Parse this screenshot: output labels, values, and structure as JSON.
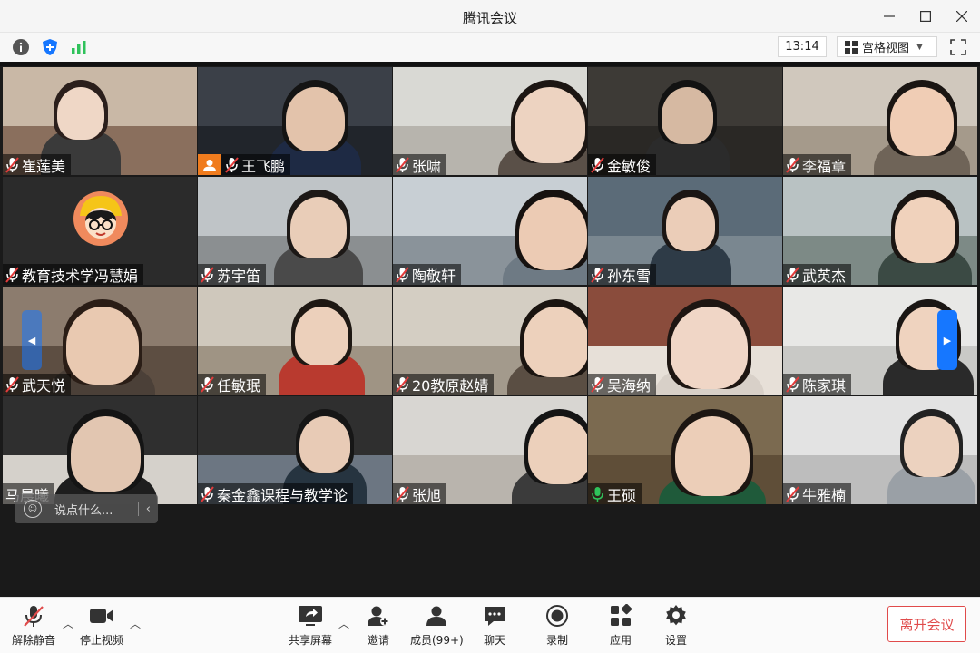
{
  "window": {
    "title": "腾讯会议"
  },
  "infobar": {
    "time": "13:14",
    "view_label": "宫格视图"
  },
  "participants": [
    {
      "name": "崔莲美",
      "mic": "muted"
    },
    {
      "name": "王飞鹏",
      "mic": "muted",
      "badge": "person"
    },
    {
      "name": "张啸",
      "mic": "muted"
    },
    {
      "name": "金敏俊",
      "mic": "muted"
    },
    {
      "name": "李福章",
      "mic": "muted"
    },
    {
      "name": "教育技术学冯慧娟",
      "mic": "muted",
      "avatar": true
    },
    {
      "name": "苏宇笛",
      "mic": "muted"
    },
    {
      "name": "陶敬轩",
      "mic": "muted"
    },
    {
      "name": "孙东雪",
      "mic": "muted"
    },
    {
      "name": "武英杰",
      "mic": "muted"
    },
    {
      "name": "武天悦",
      "mic": "muted"
    },
    {
      "name": "任敏珉",
      "mic": "muted"
    },
    {
      "name": "20教原赵婧",
      "mic": "muted"
    },
    {
      "name": "吴海纳",
      "mic": "muted"
    },
    {
      "name": "陈家琪",
      "mic": "muted"
    },
    {
      "name": "马晨曦",
      "mic": "none"
    },
    {
      "name": "秦金鑫课程与教学论",
      "mic": "muted"
    },
    {
      "name": "张旭",
      "mic": "muted"
    },
    {
      "name": "王硕",
      "mic": "active"
    },
    {
      "name": "牛雅楠",
      "mic": "muted"
    }
  ],
  "chat_input": {
    "placeholder": "说点什么..."
  },
  "toolbar": {
    "mute": "解除静音",
    "video": "停止视频",
    "share": "共享屏幕",
    "invite": "邀请",
    "members": "成员(99+)",
    "chat": "聊天",
    "record": "录制",
    "apps": "应用",
    "settings": "设置",
    "leave": "离开会议"
  },
  "colors": {
    "accent": "#1677ff",
    "leave": "#e04b4b",
    "active_mic": "#2fc25b",
    "muted_mic": "#e33b3b",
    "badge": "#f07c1e"
  }
}
